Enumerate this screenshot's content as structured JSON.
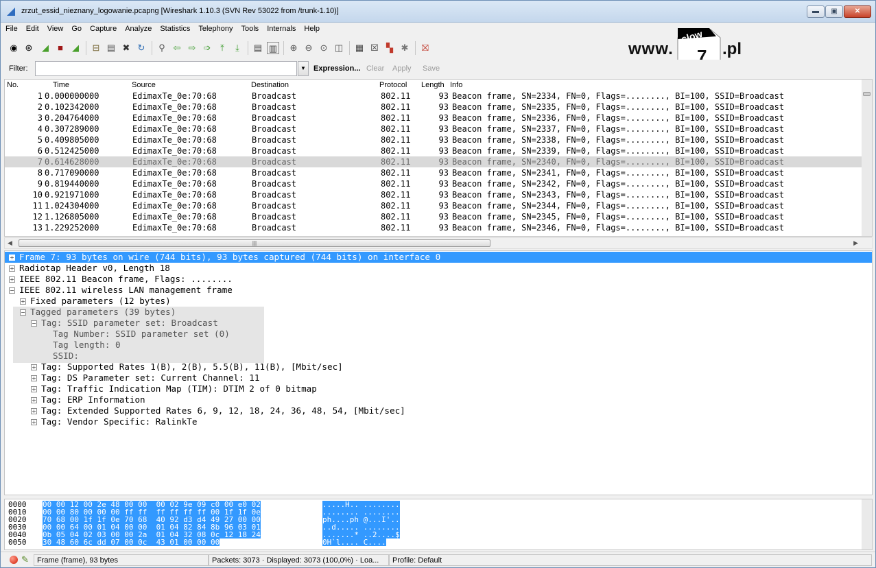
{
  "window": {
    "title": "zrzut_essid_nieznany_logowanie.pcapng  [Wireshark 1.10.3  (SVN Rev 53022 from /trunk-1.10)]",
    "buttons": [
      "▬",
      "▣",
      "✕"
    ]
  },
  "menu": [
    "File",
    "Edit",
    "View",
    "Go",
    "Capture",
    "Analyze",
    "Statistics",
    "Telephony",
    "Tools",
    "Internals",
    "Help"
  ],
  "toolbar_icons": [
    "interface-list-icon",
    "capture-options-icon",
    "start-capture-icon",
    "stop-capture-icon",
    "restart-capture-icon",
    "open-file-icon",
    "save-file-icon",
    "close-file-icon",
    "reload-icon",
    "find-packet-icon",
    "go-back-icon",
    "go-forward-icon",
    "go-to-packet-icon",
    "go-first-icon",
    "go-last-icon",
    "colorize-icon",
    "auto-scroll-icon",
    "zoom-in-icon",
    "zoom-out-icon",
    "zoom-normal-icon",
    "resize-columns-icon",
    "capture-filters-icon",
    "display-filters-icon",
    "coloring-rules-icon",
    "preferences-icon",
    "help-icon"
  ],
  "logo": {
    "www": "www.",
    "slow": "slow",
    "seven": "7",
    "pl": ".pl"
  },
  "filter": {
    "label": "Filter:",
    "value": "",
    "expression": "Expression...",
    "clear": "Clear",
    "apply": "Apply",
    "save": "Save"
  },
  "packet_list": {
    "columns": [
      "No.",
      "Time",
      "Source",
      "Destination",
      "Protocol",
      "Length",
      "Info"
    ],
    "selected_row": 6,
    "rows": [
      {
        "no": "1",
        "time": "0.000000000",
        "src": "EdimaxTe_0e:70:68",
        "dst": "Broadcast",
        "proto": "802.11",
        "len": "93",
        "info": "Beacon frame, SN=2334, FN=0, Flags=........, BI=100, SSID=Broadcast"
      },
      {
        "no": "2",
        "time": "0.102342000",
        "src": "EdimaxTe_0e:70:68",
        "dst": "Broadcast",
        "proto": "802.11",
        "len": "93",
        "info": "Beacon frame, SN=2335, FN=0, Flags=........, BI=100, SSID=Broadcast"
      },
      {
        "no": "3",
        "time": "0.204764000",
        "src": "EdimaxTe_0e:70:68",
        "dst": "Broadcast",
        "proto": "802.11",
        "len": "93",
        "info": "Beacon frame, SN=2336, FN=0, Flags=........, BI=100, SSID=Broadcast"
      },
      {
        "no": "4",
        "time": "0.307289000",
        "src": "EdimaxTe_0e:70:68",
        "dst": "Broadcast",
        "proto": "802.11",
        "len": "93",
        "info": "Beacon frame, SN=2337, FN=0, Flags=........, BI=100, SSID=Broadcast"
      },
      {
        "no": "5",
        "time": "0.409805000",
        "src": "EdimaxTe_0e:70:68",
        "dst": "Broadcast",
        "proto": "802.11",
        "len": "93",
        "info": "Beacon frame, SN=2338, FN=0, Flags=........, BI=100, SSID=Broadcast"
      },
      {
        "no": "6",
        "time": "0.512425000",
        "src": "EdimaxTe_0e:70:68",
        "dst": "Broadcast",
        "proto": "802.11",
        "len": "93",
        "info": "Beacon frame, SN=2339, FN=0, Flags=........, BI=100, SSID=Broadcast"
      },
      {
        "no": "7",
        "time": "0.614628000",
        "src": "EdimaxTe_0e:70:68",
        "dst": "Broadcast",
        "proto": "802.11",
        "len": "93",
        "info": "Beacon frame, SN=2340, FN=0, Flags=........, BI=100, SSID=Broadcast"
      },
      {
        "no": "8",
        "time": "0.717090000",
        "src": "EdimaxTe_0e:70:68",
        "dst": "Broadcast",
        "proto": "802.11",
        "len": "93",
        "info": "Beacon frame, SN=2341, FN=0, Flags=........, BI=100, SSID=Broadcast"
      },
      {
        "no": "9",
        "time": "0.819440000",
        "src": "EdimaxTe_0e:70:68",
        "dst": "Broadcast",
        "proto": "802.11",
        "len": "93",
        "info": "Beacon frame, SN=2342, FN=0, Flags=........, BI=100, SSID=Broadcast"
      },
      {
        "no": "10",
        "time": "0.921971000",
        "src": "EdimaxTe_0e:70:68",
        "dst": "Broadcast",
        "proto": "802.11",
        "len": "93",
        "info": "Beacon frame, SN=2343, FN=0, Flags=........, BI=100, SSID=Broadcast"
      },
      {
        "no": "11",
        "time": "1.024304000",
        "src": "EdimaxTe_0e:70:68",
        "dst": "Broadcast",
        "proto": "802.11",
        "len": "93",
        "info": "Beacon frame, SN=2344, FN=0, Flags=........, BI=100, SSID=Broadcast"
      },
      {
        "no": "12",
        "time": "1.126805000",
        "src": "EdimaxTe_0e:70:68",
        "dst": "Broadcast",
        "proto": "802.11",
        "len": "93",
        "info": "Beacon frame, SN=2345, FN=0, Flags=........, BI=100, SSID=Broadcast"
      },
      {
        "no": "13",
        "time": "1.229252000",
        "src": "EdimaxTe_0e:70:68",
        "dst": "Broadcast",
        "proto": "802.11",
        "len": "93",
        "info": "Beacon frame, SN=2346, FN=0, Flags=........, BI=100, SSID=Broadcast"
      }
    ]
  },
  "details": [
    {
      "indent": 0,
      "toggle": "+",
      "text": "Frame 7: 93 bytes on wire (744 bits), 93 bytes captured (744 bits) on interface 0",
      "selected": true
    },
    {
      "indent": 0,
      "toggle": "+",
      "text": "Radiotap Header v0, Length 18"
    },
    {
      "indent": 0,
      "toggle": "+",
      "text": "IEEE 802.11 Beacon frame, Flags: ........"
    },
    {
      "indent": 0,
      "toggle": "−",
      "text": "IEEE 802.11 wireless LAN management frame"
    },
    {
      "indent": 1,
      "toggle": "+",
      "text": "Fixed parameters (12 bytes)"
    },
    {
      "indent": 1,
      "toggle": "−",
      "text": "Tagged parameters (39 bytes)",
      "gray": true
    },
    {
      "indent": 2,
      "toggle": "−",
      "text": "Tag: SSID parameter set: Broadcast",
      "gray": true
    },
    {
      "indent": 3,
      "toggle": "",
      "text": "Tag Number: SSID parameter set (0)",
      "gray": true
    },
    {
      "indent": 3,
      "toggle": "",
      "text": "Tag length: 0",
      "gray": true
    },
    {
      "indent": 3,
      "toggle": "",
      "text": "SSID:",
      "gray": true
    },
    {
      "indent": 2,
      "toggle": "+",
      "text": "Tag: Supported Rates 1(B), 2(B), 5.5(B), 11(B), [Mbit/sec]"
    },
    {
      "indent": 2,
      "toggle": "+",
      "text": "Tag: DS Parameter set: Current Channel: 11"
    },
    {
      "indent": 2,
      "toggle": "+",
      "text": "Tag: Traffic Indication Map (TIM): DTIM 2 of 0 bitmap"
    },
    {
      "indent": 2,
      "toggle": "+",
      "text": "Tag: ERP Information"
    },
    {
      "indent": 2,
      "toggle": "+",
      "text": "Tag: Extended Supported Rates 6, 9, 12, 18, 24, 36, 48, 54, [Mbit/sec]"
    },
    {
      "indent": 2,
      "toggle": "+",
      "text": "Tag: Vendor Specific: RalinkTe"
    }
  ],
  "hex": [
    {
      "off": "0000",
      "bytes": "00 00 12 00 2e 48 00 00  00 02 9e 09 c0 00 e0 02",
      "ascii": ".....H.. ........"
    },
    {
      "off": "0010",
      "bytes": "00 00 80 00 00 00 ff ff  ff ff ff ff 00 1f 1f 0e",
      "ascii": "........ ........"
    },
    {
      "off": "0020",
      "bytes": "70 68 00 1f 1f 0e 70 68  40 92 d3 d4 49 27 00 00",
      "ascii": "ph....ph @...I'.."
    },
    {
      "off": "0030",
      "bytes": "00 00 64 00 01 04 00 00  01 04 82 84 8b 96 03 01",
      "ascii": "..d..... ........"
    },
    {
      "off": "0040",
      "bytes": "0b 05 04 02 03 00 00 2a  01 04 32 08 0c 12 18 24",
      "ascii": ".......* ..2....$"
    },
    {
      "off": "0050",
      "bytes": "30 48 60 6c dd 07 00 0c  43 01 00 00 00",
      "ascii": "0H`l.... C...."
    }
  ],
  "status": {
    "frame": "Frame (frame), 93 bytes",
    "packets": "Packets: 3073 · Displayed: 3073 (100,0%) · Loa...",
    "profile": "Profile: Default"
  }
}
